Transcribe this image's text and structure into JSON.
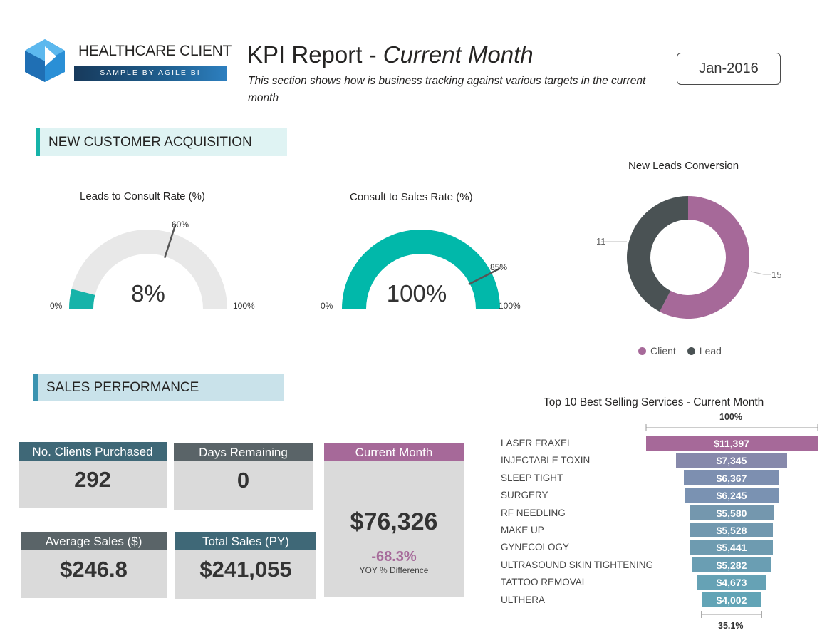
{
  "header": {
    "client_name": "HEALTHCARE CLIENT",
    "client_tagline": "SAMPLE BY AGILE BI",
    "title_main": "KPI Report - ",
    "title_italic": "Current Month",
    "subtitle": "This section shows how is business tracking against various targets in the current month",
    "date": "Jan-2016"
  },
  "sections": {
    "acquisition": "NEW CUSTOMER ACQUISITION",
    "sales": "SALES PERFORMANCE"
  },
  "gauges": [
    {
      "title": "Leads to Consult Rate (%)",
      "value_label": "8%",
      "value": 8,
      "target": 60,
      "target_label": "60%",
      "min_label": "0%",
      "max_label": "100%",
      "fill_color": "#16b3a9"
    },
    {
      "title": "Consult to Sales Rate (%)",
      "value_label": "100%",
      "value": 100,
      "target": 85,
      "target_label": "85%",
      "min_label": "0%",
      "max_label": "100%",
      "fill_color": "#01b8aa"
    }
  ],
  "donut": {
    "title": "New Leads Conversion",
    "client_value": "15",
    "lead_value": "11",
    "legend": [
      "Client",
      "Lead"
    ],
    "colors": {
      "client": "#a66999",
      "lead": "#4a5254"
    }
  },
  "kpis": {
    "clients_purchased": {
      "label": "No. Clients Purchased",
      "value": "292"
    },
    "days_remaining": {
      "label": "Days Remaining",
      "value": "0"
    },
    "current_month": {
      "label": "Current Month",
      "value": "$76,326",
      "yoy_pct": "-68.3%",
      "yoy_label": "YOY % Difference"
    },
    "average_sales": {
      "label": "Average Sales ($)",
      "value": "$246.8"
    },
    "total_sales_py": {
      "label": "Total Sales (PY)",
      "value": "$241,055"
    }
  },
  "chart_data": {
    "type": "bar",
    "title": "Top 10 Best Selling Services - Current Month",
    "top_label": "100%",
    "bottom_label": "35.1%",
    "categories": [
      "LASER FRAXEL",
      "INJECTABLE TOXIN",
      "SLEEP TIGHT",
      "SURGERY",
      "RF NEEDLING",
      "MAKE UP",
      "GYNECOLOGY",
      "ULTRASOUND SKIN TIGHTENING",
      "TATTOO REMOVAL",
      "ULTHERA"
    ],
    "values": [
      11397,
      7345,
      6367,
      6245,
      5580,
      5528,
      5441,
      5282,
      4673,
      4002
    ],
    "value_labels": [
      "$11,397",
      "$7,345",
      "$6,367",
      "$6,245",
      "$5,580",
      "$5,528",
      "$5,441",
      "$5,282",
      "$4,673",
      "$4,002"
    ],
    "colors": [
      "#a66999",
      "#8789ab",
      "#7d8fb0",
      "#7a92b2",
      "#7497ae",
      "#7198af",
      "#6e9bb0",
      "#6a9eb3",
      "#66a2b5",
      "#62a4b6"
    ]
  }
}
